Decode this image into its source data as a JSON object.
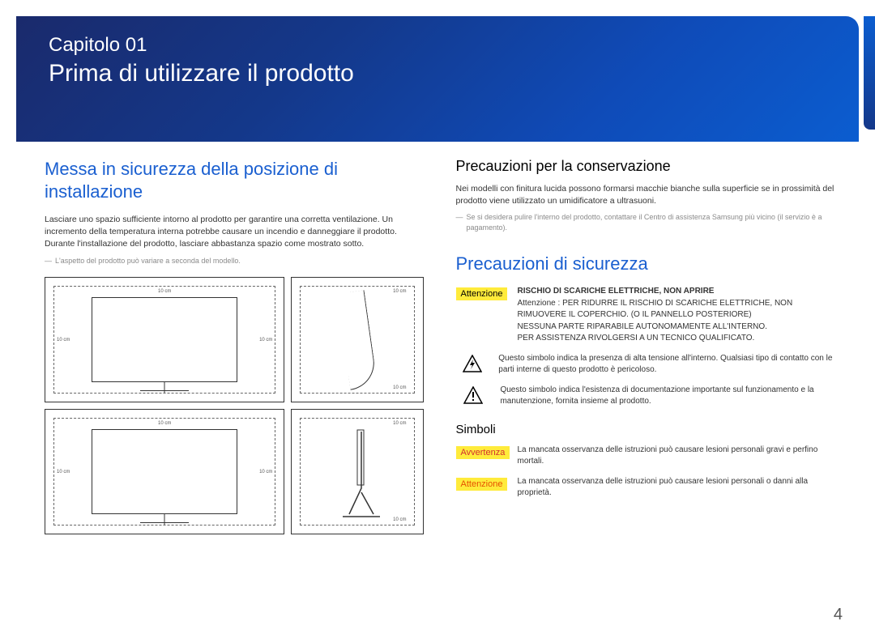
{
  "banner": {
    "chapter_label": "Capitolo 01",
    "chapter_title": "Prima di utilizzare il prodotto"
  },
  "left": {
    "heading": "Messa in sicurezza della posizione di installazione",
    "body": "Lasciare uno spazio sufficiente intorno al prodotto per garantire una corretta ventilazione. Un incremento della temperatura interna potrebbe causare un incendio e danneggiare il prodotto. Durante l'installazione del prodotto, lasciare abbastanza spazio come mostrato sotto.",
    "note": "L'aspetto del prodotto può variare a seconda del modello.",
    "dims": {
      "top": "10 cm",
      "left": "10 cm",
      "right": "10 cm",
      "bottom_side": "10 cm"
    }
  },
  "right": {
    "storage_heading": "Precauzioni per la conservazione",
    "storage_body": "Nei modelli con finitura lucida possono formarsi macchie bianche sulla superficie se in prossimità del prodotto viene utilizzato un umidificatore a ultrasuoni.",
    "storage_note": "Se si desidera pulire l'interno del prodotto, contattare il Centro di assistenza Samsung più vicino (il servizio è a pagamento).",
    "safety_heading": "Precauzioni di sicurezza",
    "attenzione_tag": "Attenzione",
    "shock_title": "RISCHIO DI SCARICHE ELETTRICHE, NON APRIRE",
    "shock_lines": [
      "Attenzione : PER RIDURRE IL RISCHIO DI SCARICHE ELETTRICHE, NON RIMUOVERE IL COPERCHIO. (O IL PANNELLO POSTERIORE)",
      "NESSUNA PARTE RIPARABILE AUTONOMAMENTE ALL'INTERNO.",
      "PER ASSISTENZA RIVOLGERSI A UN TECNICO QUALIFICATO."
    ],
    "bolt_text": "Questo simbolo indica la presenza di alta tensione all'interno. Qualsiasi tipo di contatto con le parti interne di questo prodotto è pericoloso.",
    "excl_text": "Questo simbolo indica l'esistenza di documentazione importante sul funzionamento e la manutenzione, fornita insieme al prodotto.",
    "simboli_heading": "Simboli",
    "avvertenza_tag": "Avvertenza",
    "avvertenza_text": "La mancata osservanza delle istruzioni può causare lesioni personali gravi e perfino mortali.",
    "attenzione2_tag": "Attenzione",
    "attenzione2_text": "La mancata osservanza delle istruzioni può causare lesioni personali o danni alla proprietà."
  },
  "page_number": "4"
}
